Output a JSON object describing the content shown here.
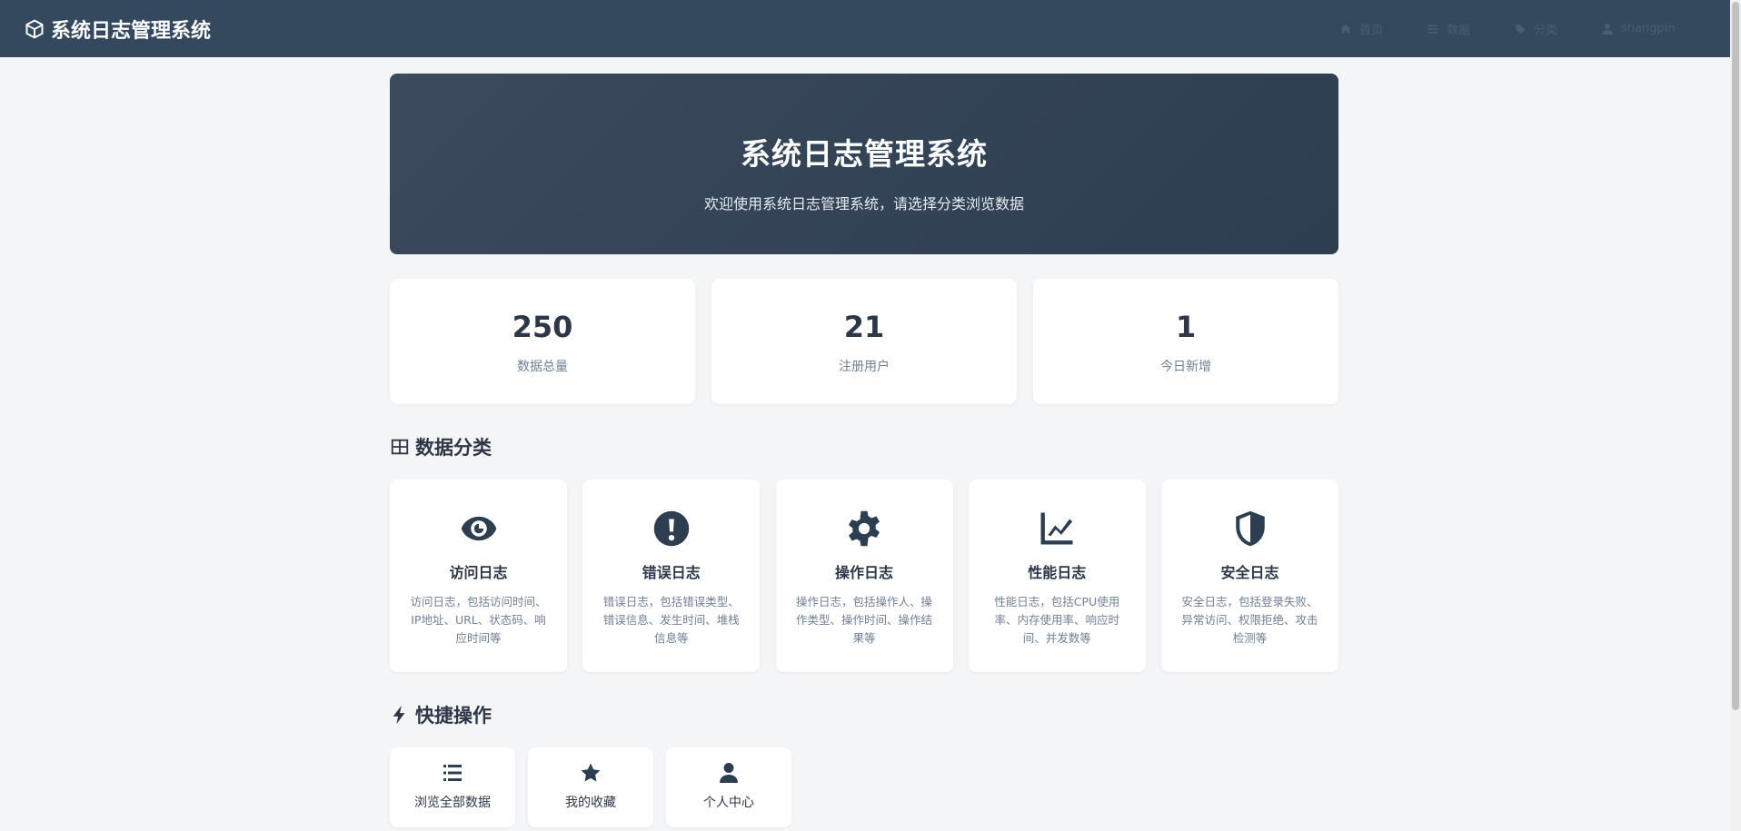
{
  "navbar": {
    "brand": "系统日志管理系统",
    "links": [
      {
        "label": "首页",
        "icon": "home-icon"
      },
      {
        "label": "数据",
        "icon": "list-icon"
      },
      {
        "label": "分类",
        "icon": "tags-icon"
      },
      {
        "label": "shangpin",
        "icon": "user-icon"
      }
    ]
  },
  "hero": {
    "title": "系统日志管理系统",
    "subtitle": "欢迎使用系统日志管理系统，请选择分类浏览数据"
  },
  "stats": [
    {
      "value": "250",
      "label": "数据总量"
    },
    {
      "value": "21",
      "label": "注册用户"
    },
    {
      "value": "1",
      "label": "今日新增"
    }
  ],
  "categories_section": {
    "title": "数据分类",
    "icon": "grid-icon"
  },
  "categories": [
    {
      "title": "访问日志",
      "desc": "访问日志，包括访问时间、IP地址、URL、状态码、响应时间等",
      "icon": "eye-icon"
    },
    {
      "title": "错误日志",
      "desc": "错误日志，包括错误类型、错误信息、发生时间、堆栈信息等",
      "icon": "exclamation-icon"
    },
    {
      "title": "操作日志",
      "desc": "操作日志，包括操作人、操作类型、操作时间、操作结果等",
      "icon": "gear-icon"
    },
    {
      "title": "性能日志",
      "desc": "性能日志，包括CPU使用率、内存使用率、响应时间、并发数等",
      "icon": "chart-line-icon"
    },
    {
      "title": "安全日志",
      "desc": "安全日志，包括登录失败、异常访问、权限拒绝、攻击检测等",
      "icon": "shield-icon"
    }
  ],
  "quick_section": {
    "title": "快捷操作",
    "icon": "bolt-icon"
  },
  "quick_actions": [
    {
      "label": "浏览全部数据",
      "icon": "list-icon"
    },
    {
      "label": "我的收藏",
      "icon": "star-icon"
    },
    {
      "label": "个人中心",
      "icon": "user-icon"
    }
  ],
  "colors": {
    "navbar": "#34495e",
    "accent": "#2c3e50",
    "background": "#f4f5f7"
  }
}
